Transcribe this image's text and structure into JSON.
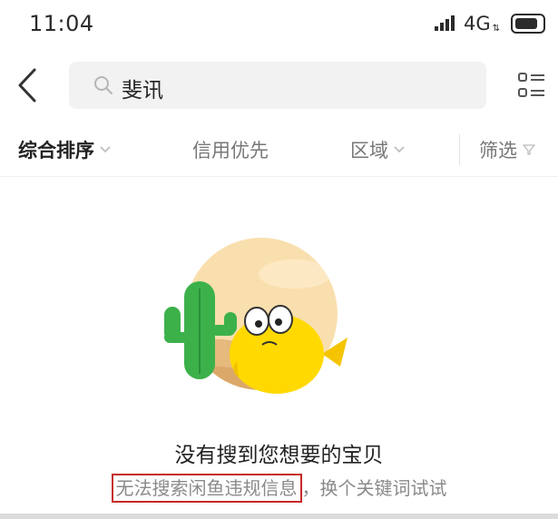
{
  "status_bar": {
    "time": "11:04",
    "network": "4G"
  },
  "search": {
    "query": "斐讯"
  },
  "filters": {
    "sort": "综合排序",
    "credit": "信用优先",
    "region": "区域",
    "screen": "筛选"
  },
  "empty_state": {
    "title": "没有搜到您想要的宝贝",
    "subtitle_highlight": "无法搜索闲鱼违规信息",
    "subtitle_separator": "，",
    "subtitle_rest": "换个关键词试试"
  },
  "icons": {
    "back": "chevron-left-icon",
    "search": "search-icon",
    "list_toggle": "list-view-icon",
    "filter": "funnel-icon"
  },
  "colors": {
    "highlight_border": "#c82828",
    "filter_active": "#222222",
    "filter_inactive": "#777777"
  }
}
